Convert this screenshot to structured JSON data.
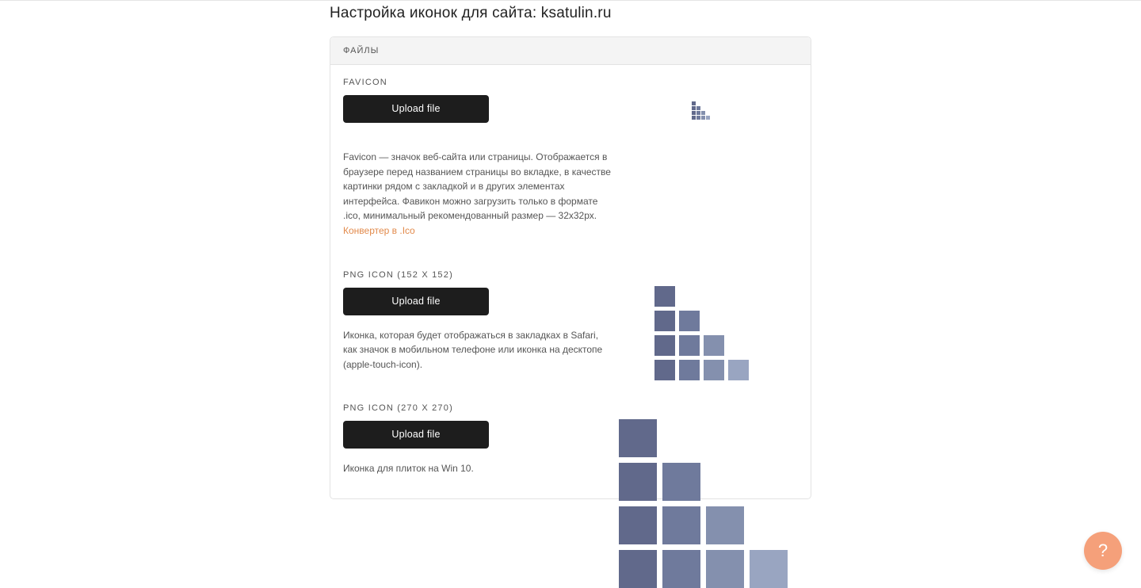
{
  "page": {
    "title": "Настройка иконок для сайта: ksatulin.ru"
  },
  "panel": {
    "header": "ФАЙЛЫ"
  },
  "sections": {
    "favicon": {
      "label": "FAVICON",
      "button": "Upload file",
      "desc_part1": "Favicon — значок веб-сайта или страницы. Отображается в браузере перед названием страницы во вкладке, в качестве картинки рядом с закладкой и в других элементах интерфейса. Фавикон можно загрузить только в формате .ico, минимальный рекомендованный размер — 32х32рх. ",
      "link_text": "Конвертер в .Ico"
    },
    "png152": {
      "label": "PNG ICON (152 X 152)",
      "button": "Upload file",
      "desc": "Иконка, которая будет отображаться в закладках в Safari, как значок в мобильном телефоне или иконка на десктопе (apple-touch-icon)."
    },
    "png270": {
      "label": "PNG ICON (270 X 270)",
      "button": "Upload file",
      "desc": "Иконка для плиток на Win 10."
    }
  },
  "help": {
    "symbol": "?"
  }
}
